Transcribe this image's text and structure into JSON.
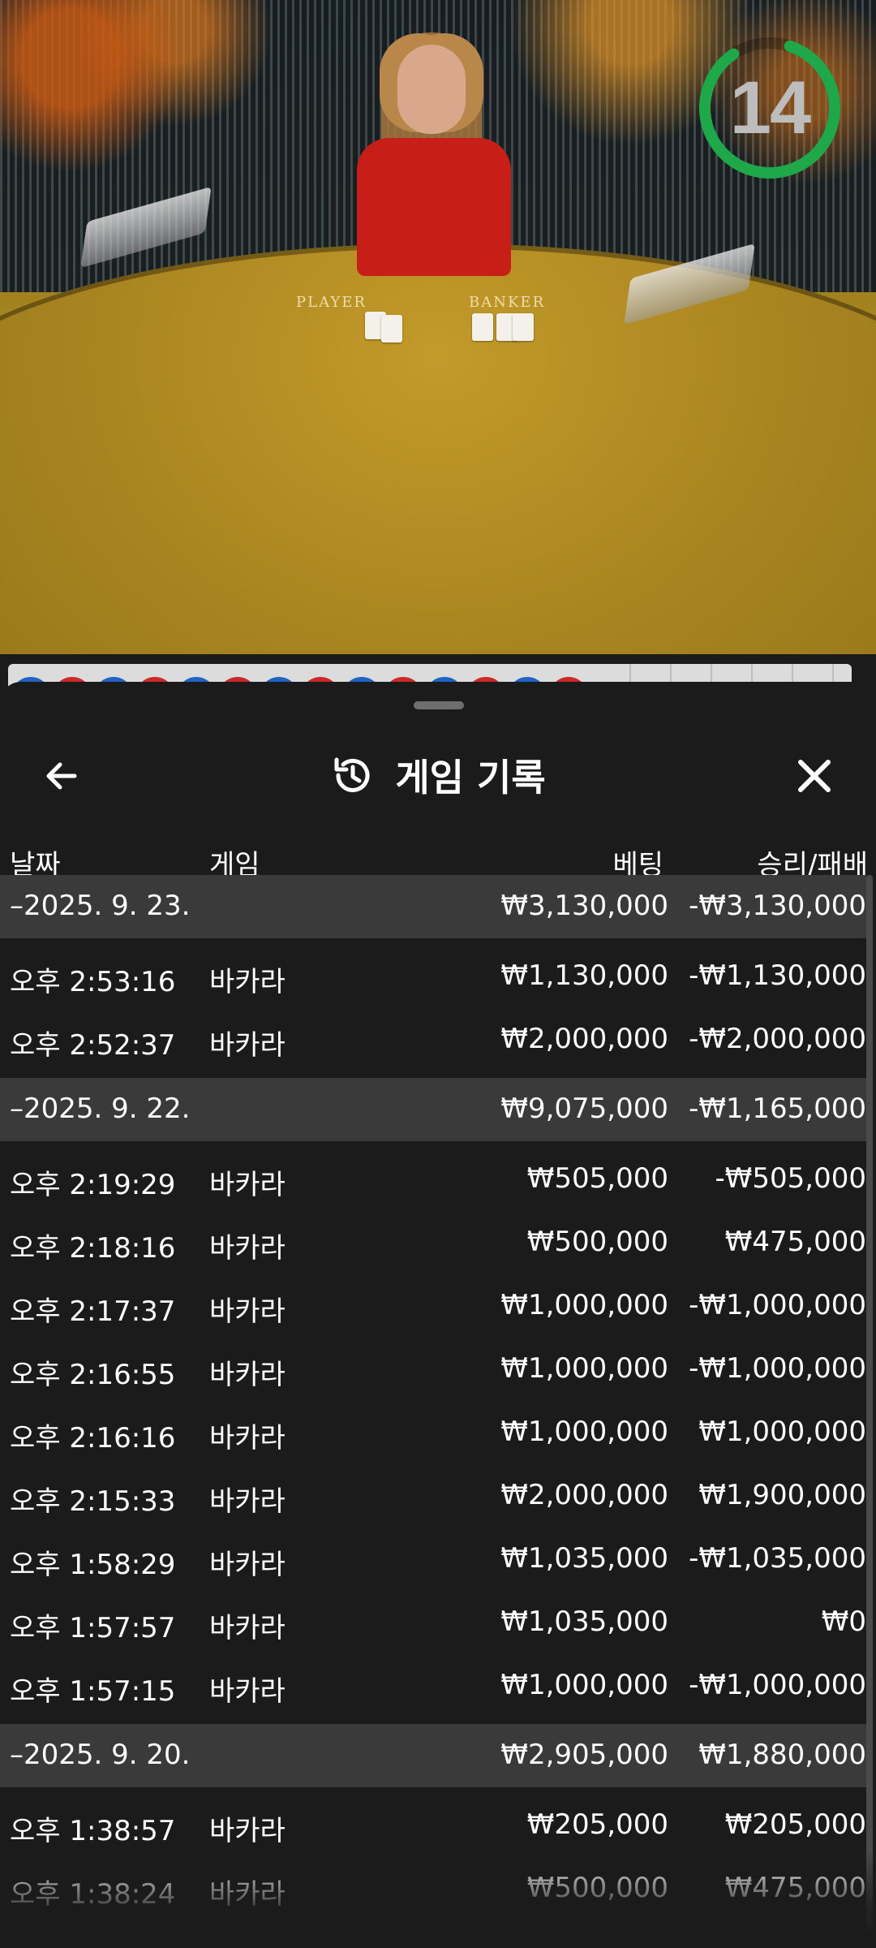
{
  "timer": {
    "value": "14"
  },
  "table_labels": {
    "player": "PLAYER",
    "banker": "BANKER"
  },
  "road": {
    "beads": [
      "blue",
      "red",
      "blue",
      "red",
      "blue",
      "red",
      "blue",
      "red",
      "blue",
      "red",
      "blue",
      "red",
      "blue",
      "red"
    ]
  },
  "header": {
    "title": "게임 기록",
    "back_icon": "arrow-left-icon",
    "history_icon": "history-icon",
    "close_icon": "close-icon"
  },
  "columns": {
    "date": "날짜",
    "game": "게임",
    "bet": "베팅",
    "result": "승리/패배"
  },
  "groups": [
    {
      "date": "–2025. 9. 23.",
      "bet": "₩3,130,000",
      "result": "-₩3,130,000",
      "rows": [
        {
          "time": "오후 2:53:16",
          "game": "바카라",
          "bet": "₩1,130,000",
          "result": "-₩1,130,000"
        },
        {
          "time": "오후 2:52:37",
          "game": "바카라",
          "bet": "₩2,000,000",
          "result": "-₩2,000,000"
        }
      ]
    },
    {
      "date": "–2025. 9. 22.",
      "bet": "₩9,075,000",
      "result": "-₩1,165,000",
      "rows": [
        {
          "time": "오후 2:19:29",
          "game": "바카라",
          "bet": "₩505,000",
          "result": "-₩505,000"
        },
        {
          "time": "오후 2:18:16",
          "game": "바카라",
          "bet": "₩500,000",
          "result": "₩475,000"
        },
        {
          "time": "오후 2:17:37",
          "game": "바카라",
          "bet": "₩1,000,000",
          "result": "-₩1,000,000"
        },
        {
          "time": "오후 2:16:55",
          "game": "바카라",
          "bet": "₩1,000,000",
          "result": "-₩1,000,000"
        },
        {
          "time": "오후 2:16:16",
          "game": "바카라",
          "bet": "₩1,000,000",
          "result": "₩1,000,000"
        },
        {
          "time": "오후 2:15:33",
          "game": "바카라",
          "bet": "₩2,000,000",
          "result": "₩1,900,000"
        },
        {
          "time": "오후 1:58:29",
          "game": "바카라",
          "bet": "₩1,035,000",
          "result": "-₩1,035,000"
        },
        {
          "time": "오후 1:57:57",
          "game": "바카라",
          "bet": "₩1,035,000",
          "result": "₩0"
        },
        {
          "time": "오후 1:57:15",
          "game": "바카라",
          "bet": "₩1,000,000",
          "result": "-₩1,000,000"
        }
      ]
    },
    {
      "date": "–2025. 9. 20.",
      "bet": "₩2,905,000",
      "result": "₩1,880,000",
      "rows": [
        {
          "time": "오후 1:38:57",
          "game": "바카라",
          "bet": "₩205,000",
          "result": "₩205,000"
        },
        {
          "time": "오후 1:38:24",
          "game": "바카라",
          "bet": "₩500,000",
          "result": "₩475,000"
        }
      ]
    }
  ],
  "colors": {
    "timer_ring": "#1fa84a",
    "sheet_bg": "#1b1b1b",
    "group_bg": "#3a3a3a",
    "text": "#ffffff",
    "bead_blue": "#1f63c4",
    "bead_red": "#cc2a2a"
  }
}
